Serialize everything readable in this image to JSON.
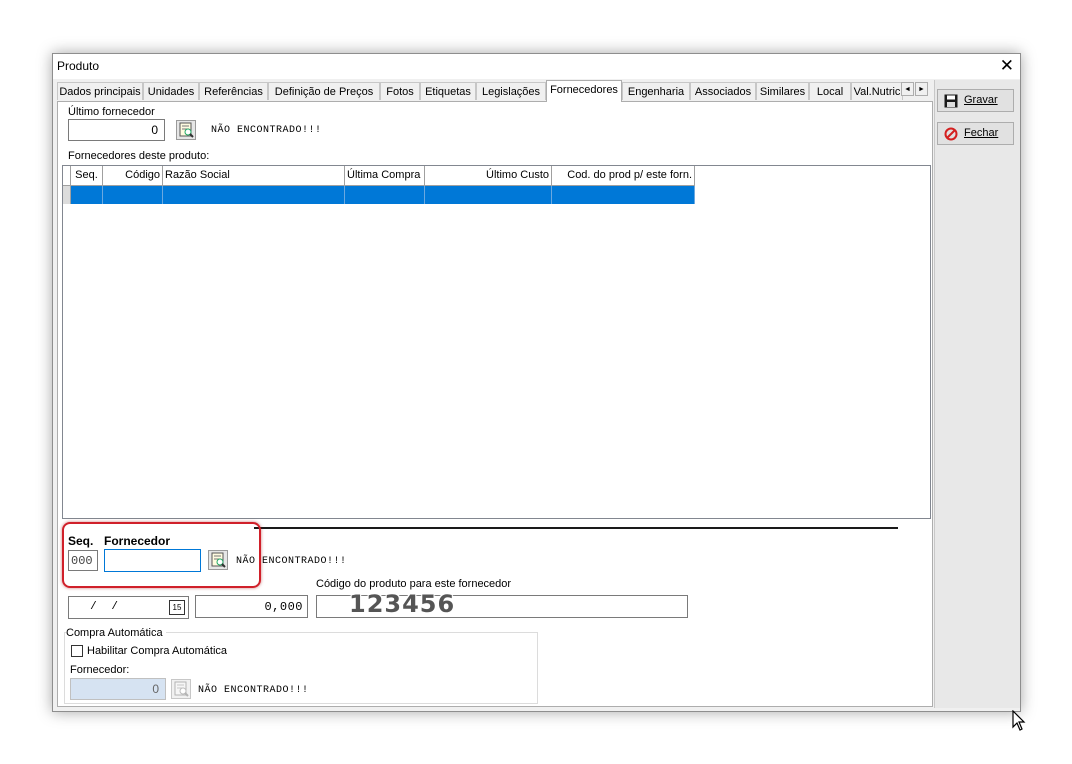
{
  "window": {
    "title": "Produto",
    "close_symbol": "✕"
  },
  "tabs": [
    {
      "label": "Dados principais"
    },
    {
      "label": "Unidades"
    },
    {
      "label": "Referências"
    },
    {
      "label": "Definição de Preços"
    },
    {
      "label": "Fotos"
    },
    {
      "label": "Etiquetas"
    },
    {
      "label": "Legislações"
    },
    {
      "label": "Fornecedores",
      "active": true
    },
    {
      "label": "Engenharia"
    },
    {
      "label": "Associados"
    },
    {
      "label": "Similares"
    },
    {
      "label": "Local"
    },
    {
      "label": "Val.Nutric"
    }
  ],
  "tab_scroll": {
    "left": "◄",
    "right": "►"
  },
  "buttons": {
    "save": "Gravar",
    "close": "Fechar"
  },
  "ultimo_fornecedor": {
    "label": "Último fornecedor",
    "value": "0",
    "status": "NÃO ENCONTRADO!!!"
  },
  "grid": {
    "caption": "Fornecedores deste produto:",
    "columns": [
      "Seq.",
      "Código",
      "Razão Social",
      "Última Compra",
      "Último Custo",
      "Cod. do prod p/ este forn."
    ],
    "rows": [
      [
        "",
        "",
        "",
        "",
        "",
        ""
      ]
    ]
  },
  "detail": {
    "seq_label": "Seq.",
    "fornecedor_label": "Fornecedor",
    "seq_value": "000",
    "fornecedor_value": "",
    "status": "NÃO ENCONTRADO!!!",
    "date_value": " /  /",
    "custo_value": "0,000",
    "codigo_label": "Código do produto para este fornecedor",
    "codigo_value": "123456"
  },
  "compra_automatica": {
    "group_label": "Compra Automática",
    "checkbox_label": "Habilitar Compra Automática",
    "checked": false,
    "fornecedor_label": "Fornecedor:",
    "fornecedor_value": "0",
    "status": "NÃO ENCONTRADO!!!"
  },
  "colors": {
    "selection": "#0078d7",
    "highlight_ring": "#d0202a",
    "window_bg": "#f0f0f0"
  }
}
